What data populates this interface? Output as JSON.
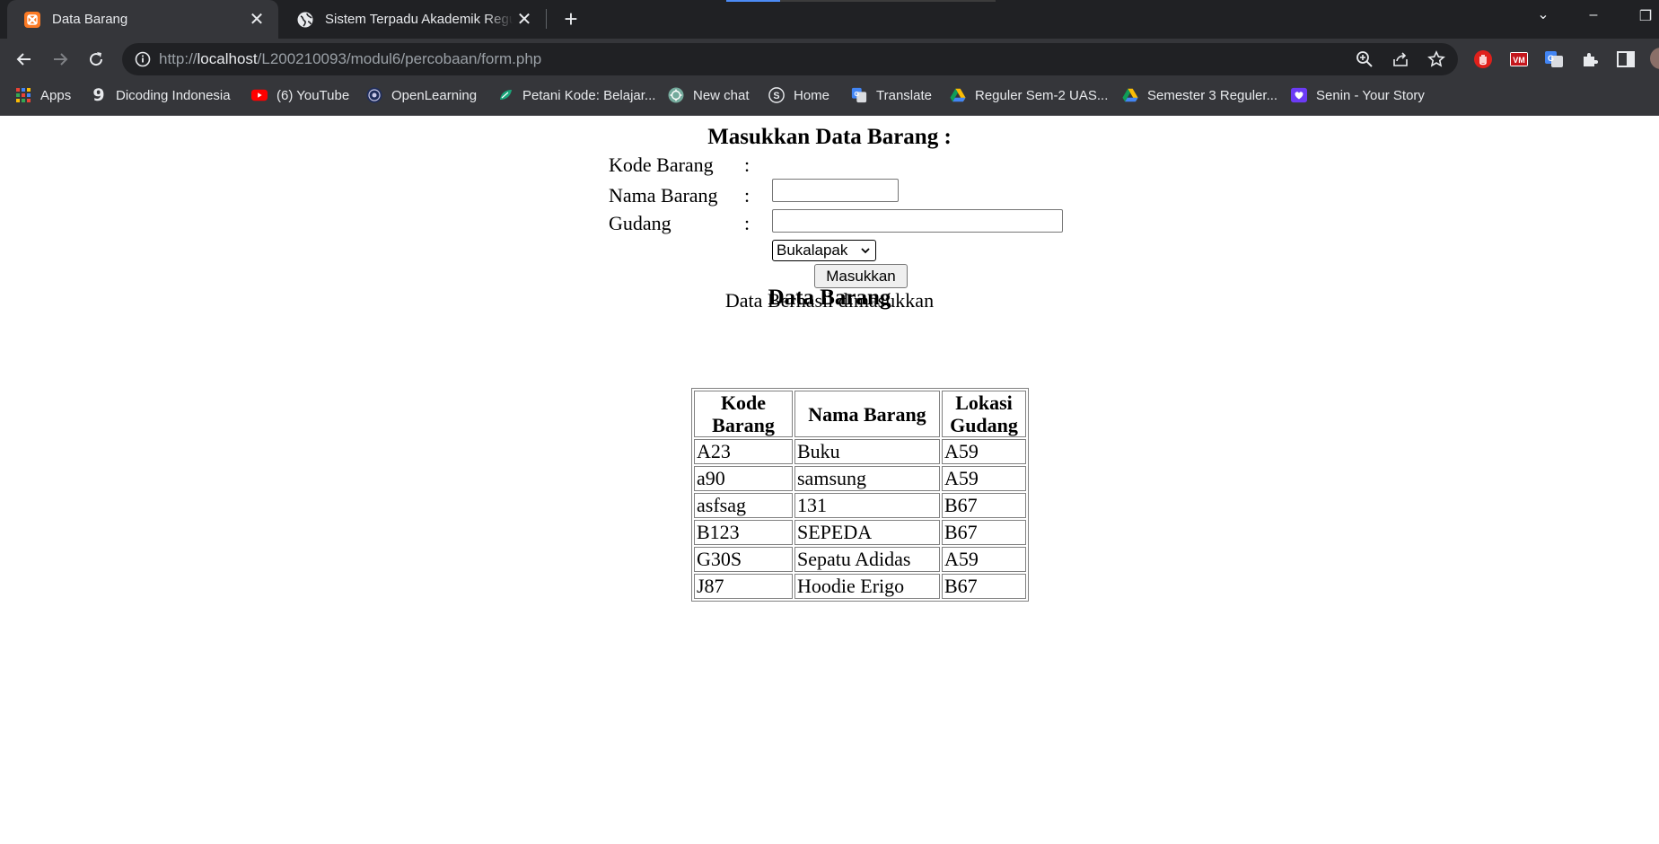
{
  "browser": {
    "tabs": [
      {
        "title": "Data Barang",
        "active": true
      },
      {
        "title": "Sistem Terpadu Akademik Reguler",
        "active": false
      }
    ],
    "url": {
      "scheme": "http://",
      "host": "localhost",
      "path": "/L200210093/modul6/percobaan/form.php"
    },
    "bookmarks": [
      {
        "label": "Apps",
        "icon": "apps-grid-icon"
      },
      {
        "label": "Dicoding Indonesia",
        "icon": "dicoding-icon"
      },
      {
        "label": "(6) YouTube",
        "icon": "youtube-icon"
      },
      {
        "label": "OpenLearning",
        "icon": "openlearning-icon"
      },
      {
        "label": "Petani Kode: Belajar...",
        "icon": "petani-kode-icon"
      },
      {
        "label": "New chat",
        "icon": "chatgpt-icon"
      },
      {
        "label": "Home",
        "icon": "skype-icon"
      },
      {
        "label": "Translate",
        "icon": "translate-icon"
      },
      {
        "label": "Reguler Sem-2 UAS...",
        "icon": "google-drive-icon"
      },
      {
        "label": "Semester 3 Reguler...",
        "icon": "google-drive-icon"
      },
      {
        "label": "Senin - Your Story",
        "icon": "heart-icon"
      }
    ]
  },
  "form": {
    "heading": "Masukkan Data Barang :",
    "fields": [
      {
        "label": "Kode Barang",
        "colon": ":",
        "value": ""
      },
      {
        "label": "Nama Barang",
        "colon": ":",
        "value": ""
      },
      {
        "label": "Gudang",
        "colon": ":",
        "selected": "Bukalapak"
      }
    ],
    "submit_label": "Masukkan",
    "message": "Data Berhasil dimasukkan"
  },
  "table": {
    "heading": "Data Barang",
    "headers": [
      [
        "Kode",
        "Barang"
      ],
      [
        "Nama Barang"
      ],
      [
        "Lokasi",
        "Gudang"
      ]
    ],
    "rows": [
      [
        "A23",
        "Buku",
        "A59"
      ],
      [
        "a90",
        "samsung",
        "A59"
      ],
      [
        "asfsag",
        "131",
        "B67"
      ],
      [
        "B123",
        "SEPEDA",
        "B67"
      ],
      [
        "G30S",
        "Sepatu Adidas",
        "A59"
      ],
      [
        "J87",
        "Hoodie Erigo",
        "B67"
      ]
    ]
  }
}
